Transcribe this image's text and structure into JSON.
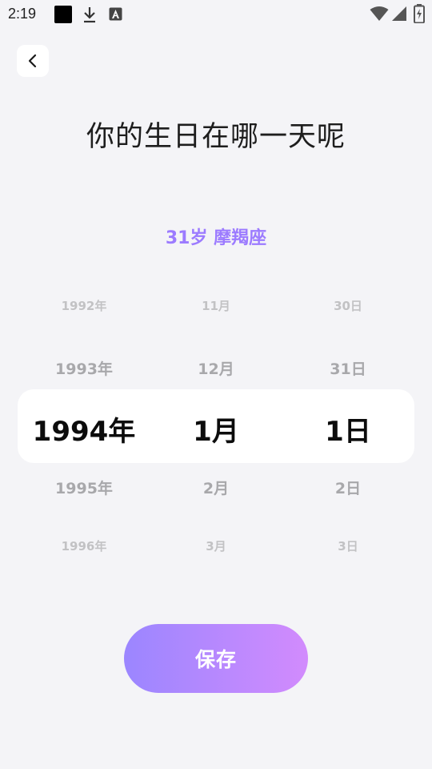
{
  "status_bar": {
    "time": "2:19",
    "icons": [
      "notification-square-icon",
      "download-icon",
      "app-notification-icon",
      "wifi-icon",
      "cellular-signal-icon",
      "battery-charging-icon"
    ]
  },
  "header": {
    "back_icon": "chevron-left-icon",
    "title": "你的生日在哪一天呢"
  },
  "summary": {
    "age_sign": "31岁 摩羯座"
  },
  "picker": {
    "years": [
      "1992年",
      "1993年",
      "1994年",
      "1995年",
      "1996年"
    ],
    "months": [
      "11月",
      "12月",
      "1月",
      "2月",
      "3月"
    ],
    "days": [
      "30日",
      "31日",
      "1日",
      "2日",
      "3日"
    ],
    "selected": {
      "year": "1994年",
      "month": "1月",
      "day": "1日"
    }
  },
  "actions": {
    "save_label": "保存"
  },
  "colors": {
    "background": "#f4f4f7",
    "accent_text": "#9c7bff",
    "button_gradient_start": "#9b86ff",
    "button_gradient_end": "#d28bfd"
  }
}
